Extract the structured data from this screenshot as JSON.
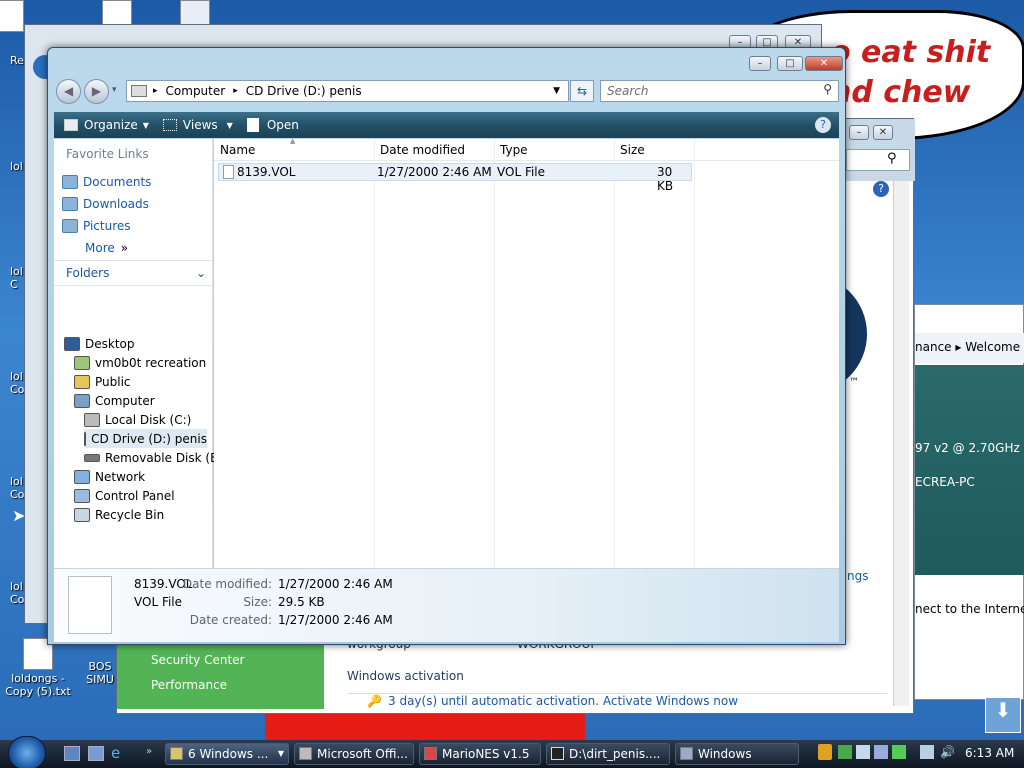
{
  "desktop": {
    "icons_left": [
      "Re",
      "lol",
      "lol C",
      "lol Co",
      "lol Co",
      "lol Co"
    ],
    "icon_bottom": "loldongs - Copy (5).txt",
    "icon_bottom2": "BOS SIMU",
    "speech_text_1": "o eat shit",
    "speech_text_2": "nd chew"
  },
  "bg_window": {
    "breadcrumb_1": "nance",
    "breadcrumb_2": "Welcome",
    "cpu_text": "97 v2 @ 2.70GHz",
    "pc_text": "ECREA-PC",
    "link_ngs": "ngs",
    "connect_text": "nect to the Internet",
    "tm": "™",
    "left_items": [
      "Security Center",
      "Performance"
    ],
    "workgroup_text": "workgroup",
    "workgroup_value": "WORKGROUP",
    "activation_heading": "Windows activation",
    "activation_text": "3 day(s) until automatic activation. Activate Windows now"
  },
  "explorer": {
    "address": {
      "computer": "Computer",
      "drive": "CD Drive (D:) penis"
    },
    "search_placeholder": "Search",
    "toolbar": {
      "organize": "Organize",
      "views": "Views",
      "open": "Open"
    },
    "favorite_links_title": "Favorite Links",
    "favorite_links": [
      "Documents",
      "Downloads",
      "Pictures"
    ],
    "more": "More",
    "folders_title": "Folders",
    "tree": [
      "Desktop",
      "vm0b0t recreation",
      "Public",
      "Computer",
      "Local Disk (C:)",
      "CD Drive (D:) penis",
      "Removable Disk (E:)",
      "Network",
      "Control Panel",
      "Recycle Bin"
    ],
    "columns": {
      "name": "Name",
      "date": "Date modified",
      "type": "Type",
      "size": "Size"
    },
    "file": {
      "name": "8139.VOL",
      "date": "1/27/2000 2:46 AM",
      "type": "VOL File",
      "size": "30 KB"
    },
    "details": {
      "name": "8139.VOL",
      "type": "VOL File",
      "date_modified_label": "Date modified:",
      "date_modified": "1/27/2000 2:46 AM",
      "size_label": "Size:",
      "size": "29.5 KB",
      "date_created_label": "Date created:",
      "date_created": "1/27/2000 2:46 AM"
    }
  },
  "taskbar": {
    "buttons": [
      "6 Windows ...",
      "Microsoft Offi...",
      "MarioNES v1.5",
      "D:\\dirt_penis....",
      "Windows"
    ],
    "clock": "6:13 AM"
  }
}
